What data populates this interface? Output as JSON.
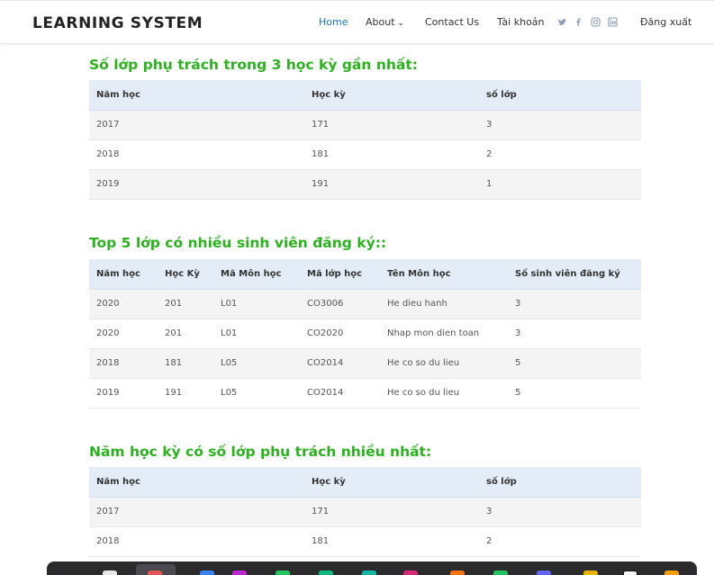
{
  "header": {
    "brand": "LEARNING SYSTEM",
    "nav": {
      "home": "Home",
      "about": "About",
      "contact": "Contact Us",
      "account": "Tài khoản",
      "logout": "Đăng xuất"
    },
    "accent_color": "#1b73c2"
  },
  "sections": {
    "s1": {
      "title": "Số lớp phụ trách trong 3 học kỳ gần nhất:",
      "headers": [
        "Năm học",
        "Học kỳ",
        "số lớp"
      ],
      "rows": [
        [
          "2017",
          "171",
          "3"
        ],
        [
          "2018",
          "181",
          "2"
        ],
        [
          "2019",
          "191",
          "1"
        ]
      ]
    },
    "s2": {
      "title": "Top 5 lớp có nhiều sinh viên đăng ký::",
      "headers": [
        "Năm học",
        "Học Kỳ",
        "Mã Môn học",
        "Mã lớp học",
        "Tên Môn học",
        "Số sinh viên đăng ký"
      ],
      "rows": [
        [
          "2020",
          "201",
          "L01",
          "CO3006",
          "He dieu hanh",
          "3"
        ],
        [
          "2020",
          "201",
          "L01",
          "CO2020",
          "Nhap mon dien toan",
          "3"
        ],
        [
          "2018",
          "181",
          "L05",
          "CO2014",
          "He co so du lieu",
          "5"
        ],
        [
          "2019",
          "191",
          "L05",
          "CO2014",
          "He co so du lieu",
          "5"
        ]
      ]
    },
    "s3": {
      "title": "Năm học kỳ có số lớp phụ trách nhiều nhất:",
      "headers": [
        "Năm học",
        "Học kỳ",
        "số lớp"
      ],
      "rows": [
        [
          "2017",
          "171",
          "3"
        ],
        [
          "2018",
          "181",
          "2"
        ]
      ]
    }
  },
  "title_color": "#2bb21f",
  "icons": [
    "twitter-icon",
    "facebook-icon",
    "instagram-icon",
    "linkedin-icon"
  ]
}
